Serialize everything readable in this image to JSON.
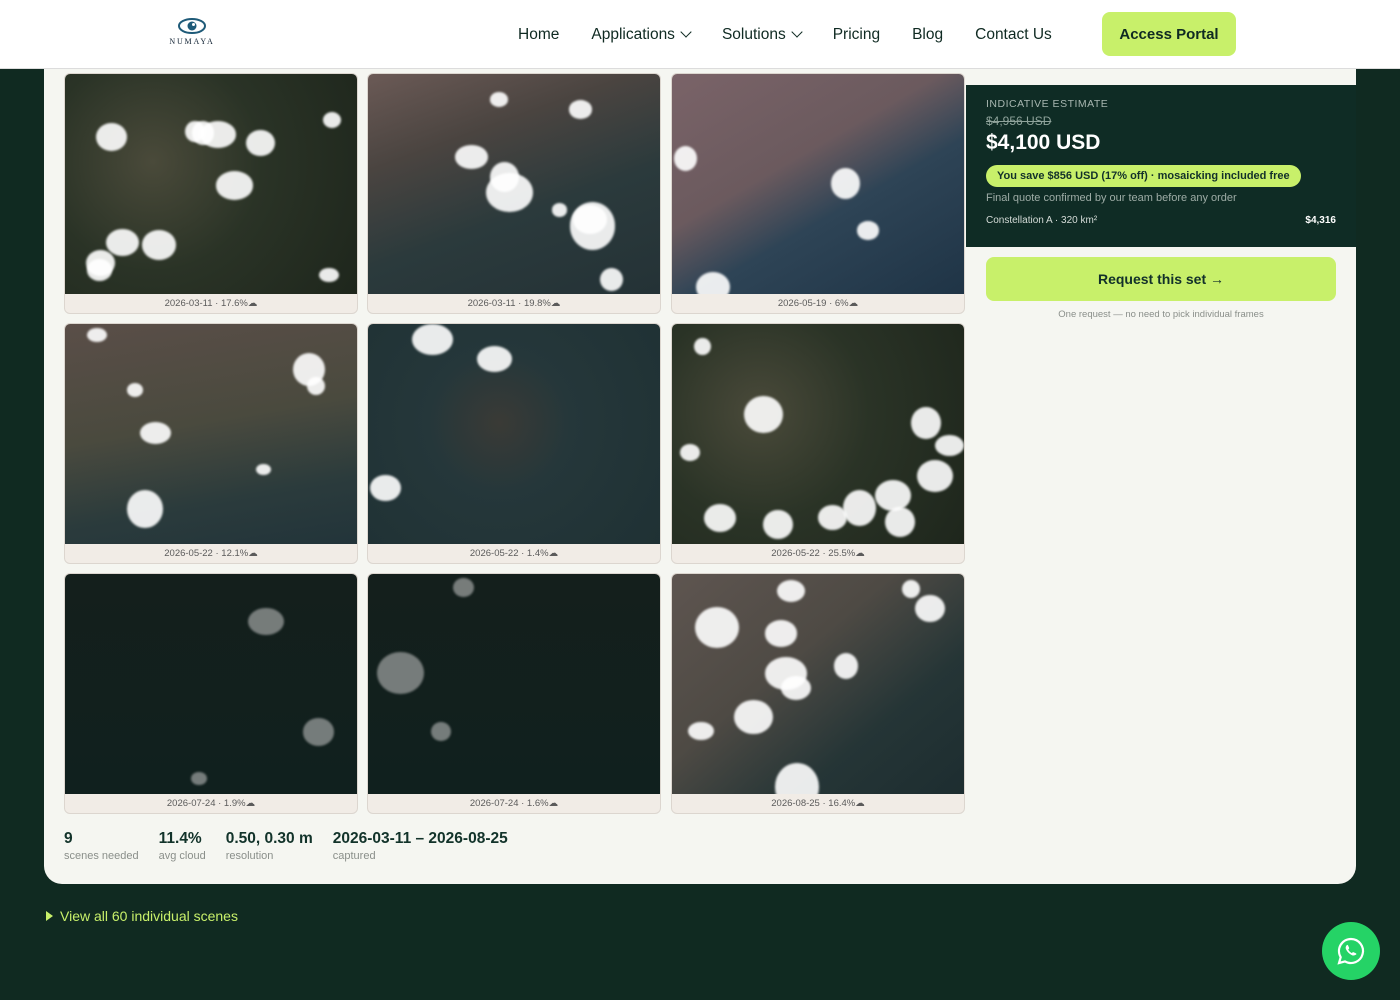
{
  "brand": {
    "logo_text": "NUMAYA"
  },
  "nav": {
    "links": [
      "Home",
      "Applications",
      "Solutions",
      "Pricing",
      "Blog",
      "Contact Us"
    ],
    "portal_label": "Access Portal"
  },
  "scenes": [
    {
      "caption": "2026-03-11 · 17.6%☁",
      "theme": "land-cloudy"
    },
    {
      "caption": "2026-03-11 · 19.8%☁",
      "theme": "port"
    },
    {
      "caption": "2026-05-19 · 6%☁",
      "theme": "coast"
    },
    {
      "caption": "2026-05-22 · 12.1%☁",
      "theme": "urban"
    },
    {
      "caption": "2026-05-22 · 1.4%☁",
      "theme": "islands"
    },
    {
      "caption": "2026-05-22 · 25.5%☁",
      "theme": "land-cloudy"
    },
    {
      "caption": "2026-07-24 · 1.9%☁",
      "theme": "dark-sea"
    },
    {
      "caption": "2026-07-24 · 1.6%☁",
      "theme": "dark-sea"
    },
    {
      "caption": "2026-08-25 · 16.4%☁",
      "theme": "urban-cloudy"
    }
  ],
  "stats": [
    {
      "value": "9",
      "label": "scenes needed"
    },
    {
      "value": "11.4%",
      "label": "avg cloud"
    },
    {
      "value": "0.50, 0.30 m",
      "label": "resolution"
    },
    {
      "value": "2026-03-11 – 2026-08-25",
      "label": "captured"
    }
  ],
  "estimate": {
    "label": "INDICATIVE ESTIMATE",
    "old_price": "$4,956 USD",
    "price": "$4,100 USD",
    "savings": "You save $856 USD (17% off) · mosaicking included free",
    "note": "Final quote confirmed by our team before any order",
    "line_label": "Constellation A · 320 km²",
    "line_price": "$4,316"
  },
  "request": {
    "button": "Request this set →",
    "note": "One request — no need to pick individual frames"
  },
  "view_all": "View all 60 individual scenes",
  "colors": {
    "accent": "#c8f06a",
    "dark": "#102a21",
    "whatsapp": "#25d366"
  }
}
